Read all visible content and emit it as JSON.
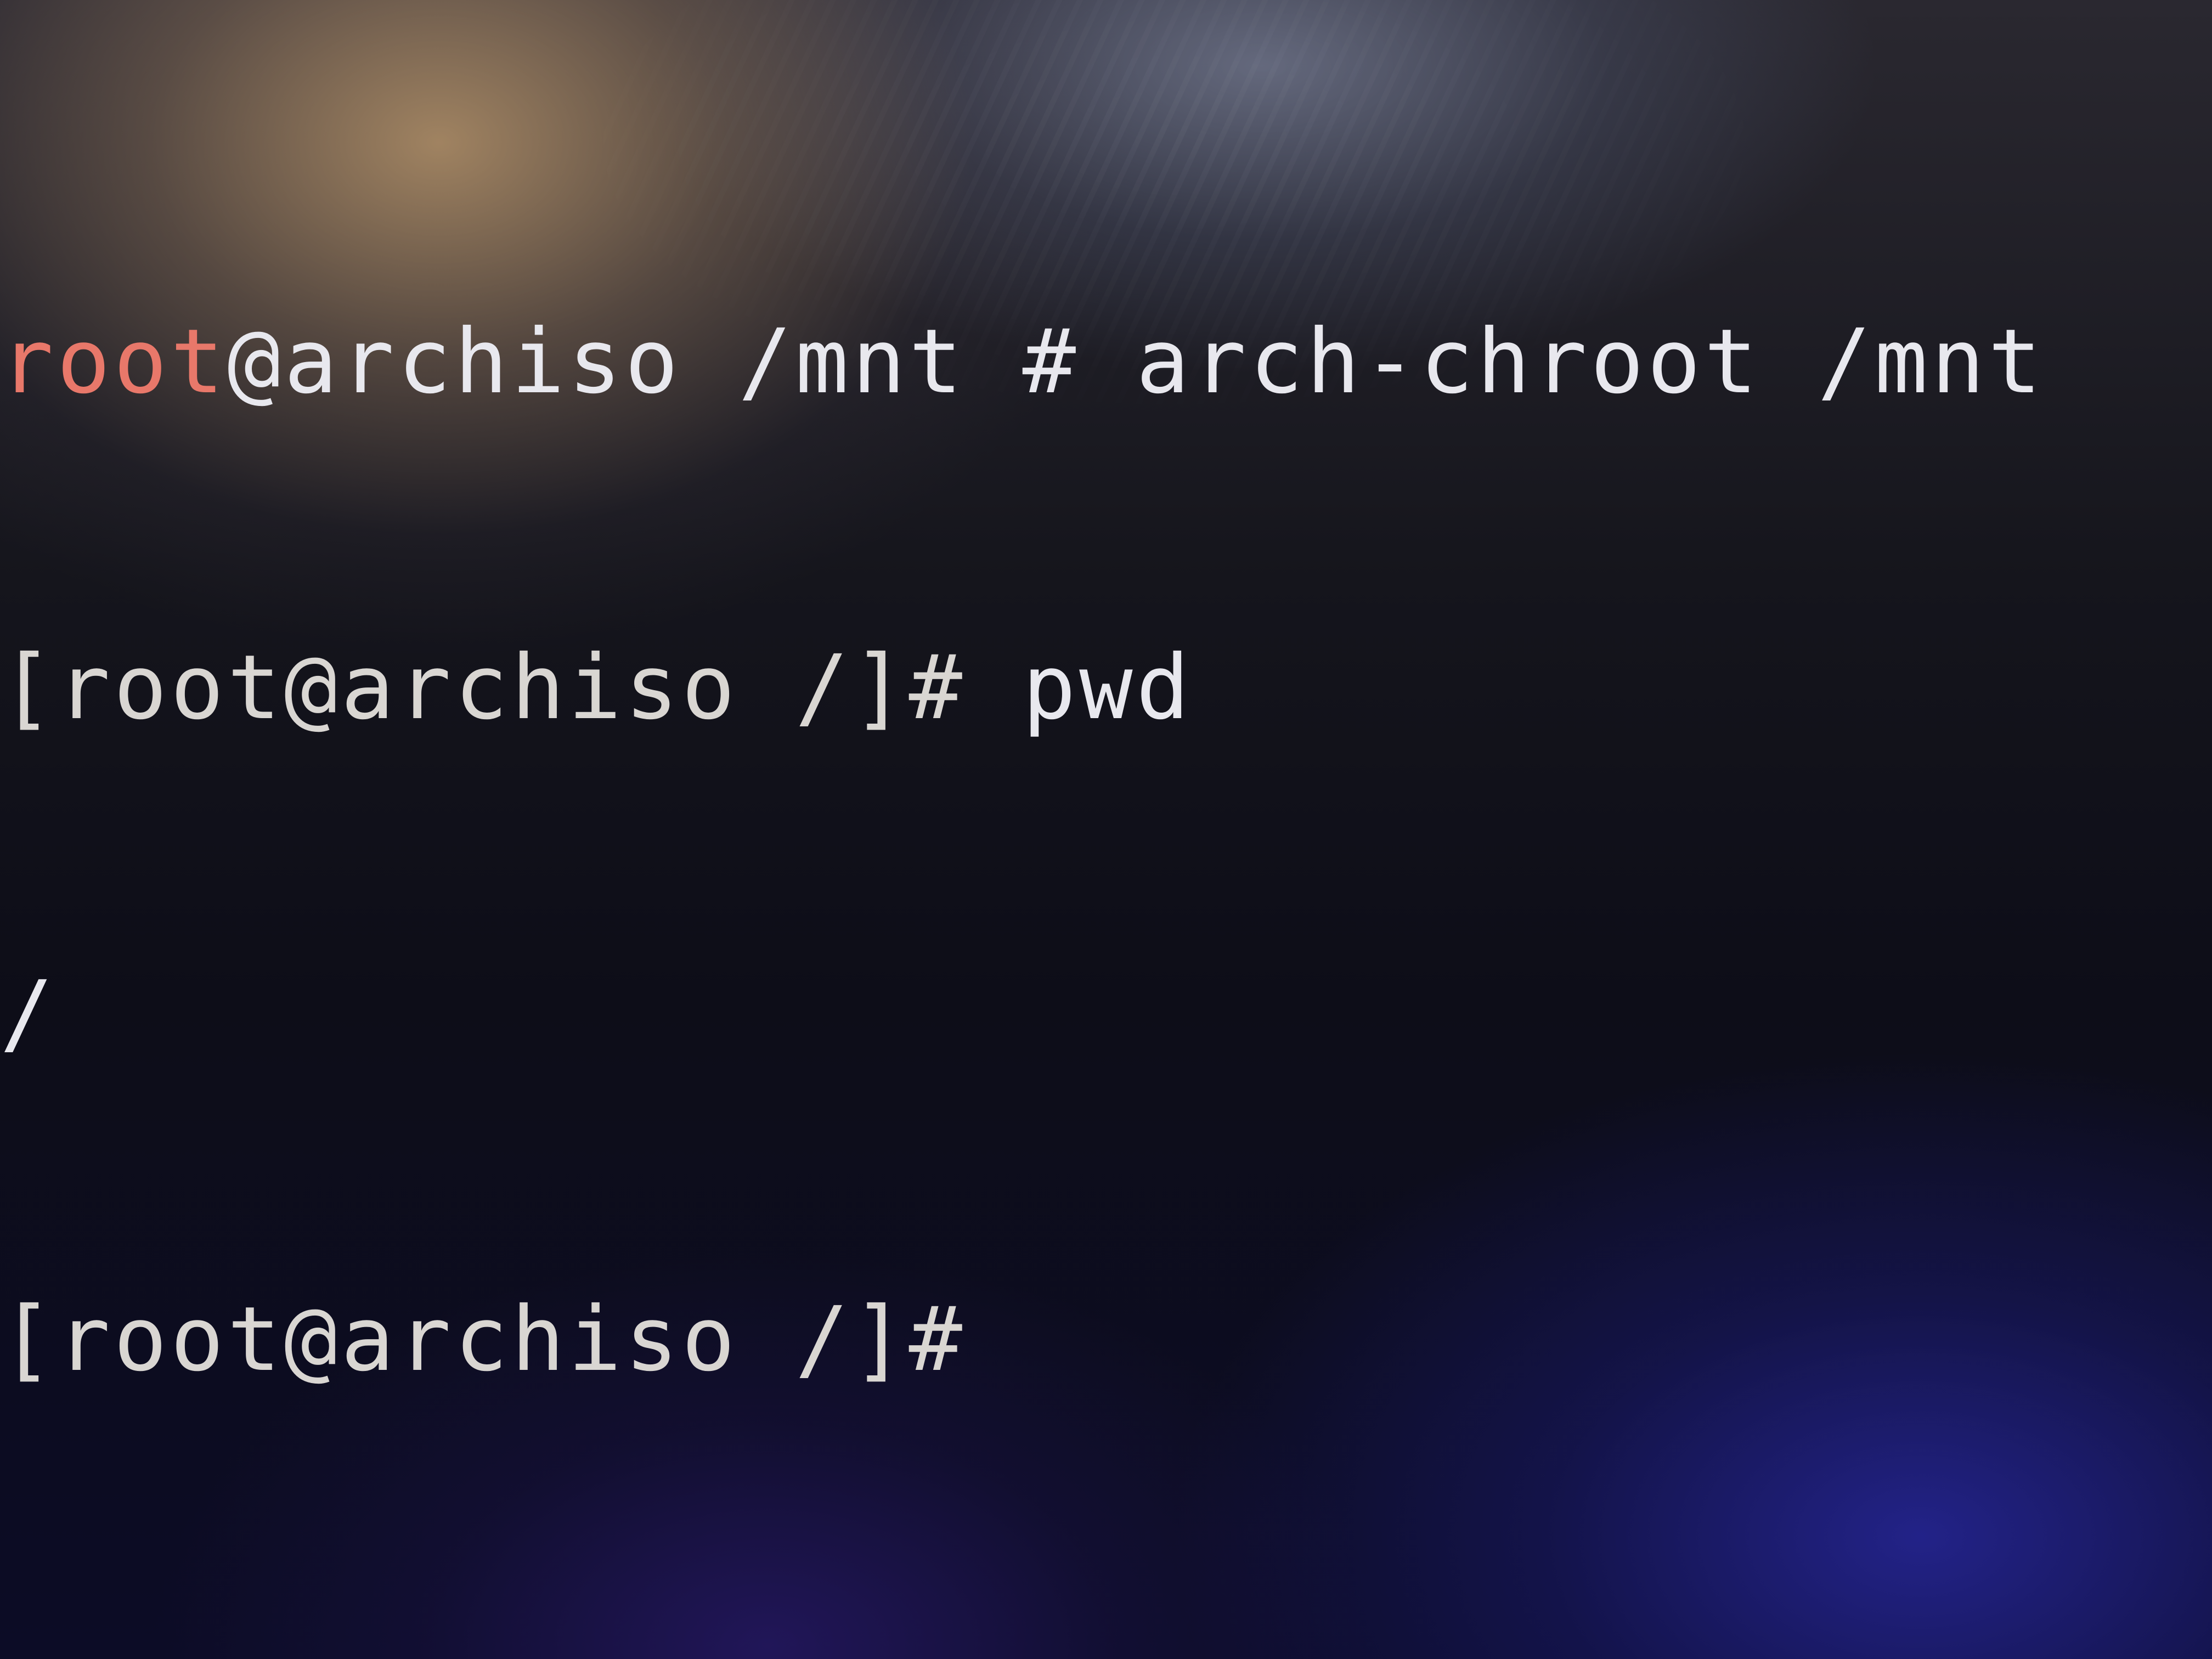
{
  "terminal": {
    "line1": {
      "user": "root",
      "rest": "@archiso /mnt # arch-chroot /mnt"
    },
    "line2": {
      "prompt": "[root@archiso /]#",
      "command": " pwd"
    },
    "line3": {
      "output": "/"
    },
    "line4": {
      "prompt": "[root@archiso /]#"
    }
  },
  "colors": {
    "username": "#e8786a",
    "text": "#e8e8ee",
    "background": "#0b0b14"
  }
}
